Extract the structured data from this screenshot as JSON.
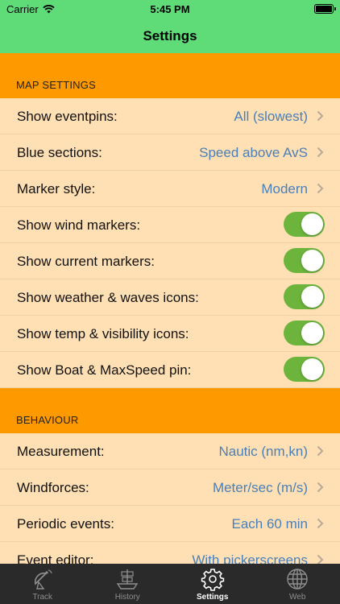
{
  "status_bar": {
    "carrier": "Carrier",
    "time": "5:45 PM"
  },
  "nav": {
    "title": "Settings"
  },
  "sections": {
    "map": {
      "header": "MAP SETTINGS",
      "rows": [
        {
          "label": "Show eventpins:",
          "value": "All (slowest)"
        },
        {
          "label": "Blue sections:",
          "value": "Speed above AvS"
        },
        {
          "label": "Marker style:",
          "value": "Modern"
        },
        {
          "label": "Show wind markers:",
          "on": true
        },
        {
          "label": "Show current markers:",
          "on": true
        },
        {
          "label": "Show weather & waves icons:",
          "on": true
        },
        {
          "label": "Show temp & visibility icons:",
          "on": true
        },
        {
          "label": "Show Boat & MaxSpeed pin:",
          "on": true
        }
      ]
    },
    "behaviour": {
      "header": "BEHAVIOUR",
      "rows": [
        {
          "label": "Measurement:",
          "value": "Nautic (nm,kn)"
        },
        {
          "label": "Windforces:",
          "value": "Meter/sec (m/s)"
        },
        {
          "label": "Periodic events:",
          "value": "Each 60 min"
        },
        {
          "label": "Event editor:",
          "value": "With pickerscreens"
        }
      ]
    }
  },
  "tabs": [
    {
      "label": "Track",
      "icon": "satellite-dish-icon",
      "active": false
    },
    {
      "label": "History",
      "icon": "ship-icon",
      "active": false
    },
    {
      "label": "Settings",
      "icon": "gear-icon",
      "active": true
    },
    {
      "label": "Web",
      "icon": "globe-icon",
      "active": false
    }
  ],
  "colors": {
    "nav_green": "#5fdc78",
    "section_orange": "#ff9900",
    "row_background": "#ffe0b4",
    "value_blue": "#4a7fb8",
    "toggle_green": "#6cb43c",
    "tab_bar": "#2a2a2a"
  }
}
